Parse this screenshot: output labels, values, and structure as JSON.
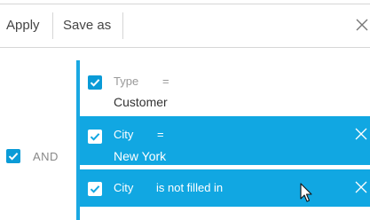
{
  "toolbar": {
    "apply_label": "Apply",
    "save_as_label": "Save as",
    "close_icon": "close-icon"
  },
  "group": {
    "operator_label": "AND",
    "checked": true
  },
  "conditions": [
    {
      "field": "Type",
      "operator": "=",
      "value": "Customer",
      "checked": true,
      "selected": false
    },
    {
      "field": "City",
      "operator": "=",
      "value": "New York",
      "checked": true,
      "selected": true
    },
    {
      "field": "City",
      "operator": "is not filled in",
      "value": "",
      "checked": true,
      "selected": true
    }
  ],
  "colors": {
    "accent": "#11a7e2",
    "checkbox": "#0a9bd7",
    "divider": "#d6d6d6"
  },
  "icons": [
    "close-icon",
    "checkmark-icon",
    "mouse-pointer-icon"
  ]
}
